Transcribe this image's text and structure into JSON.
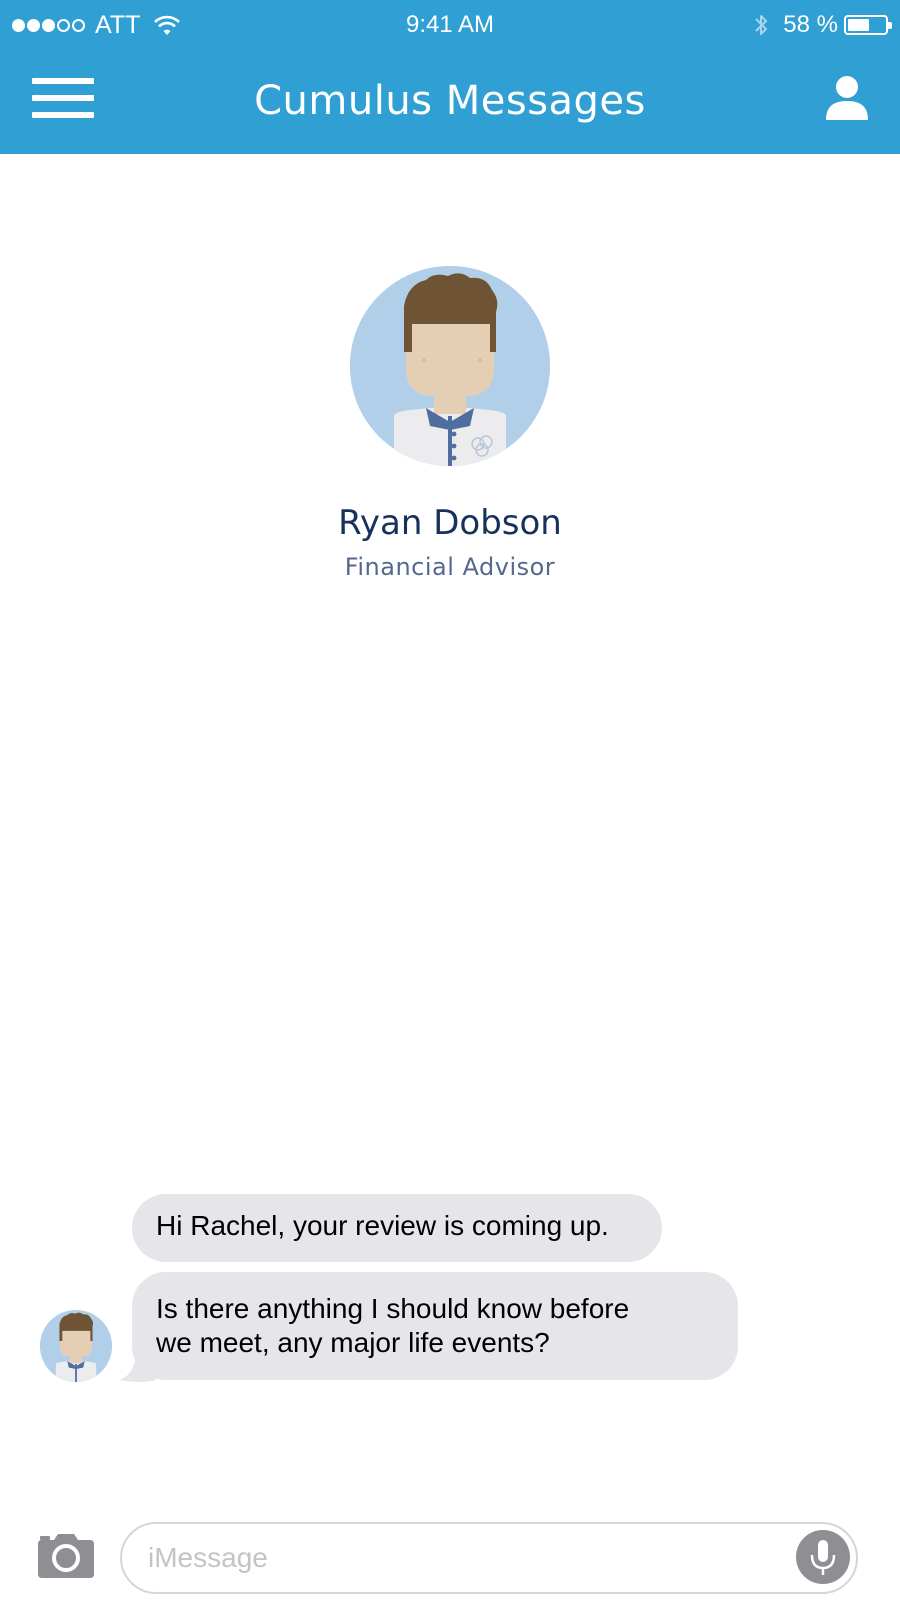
{
  "status_bar": {
    "signal_icon": "signal-dots-icon",
    "carrier": "ATT",
    "wifi_icon": "wifi-icon",
    "time": "9:41 AM",
    "bluetooth_icon": "bluetooth-icon",
    "battery_text": "58 %",
    "battery_level": 0.58
  },
  "nav": {
    "menu_icon": "hamburger-menu-icon",
    "title": "Cumulus Messages",
    "profile_icon": "person-icon"
  },
  "contact": {
    "avatar_icon": "person-avatar-icon",
    "name": "Ryan Dobson",
    "role": "Financial Advisor"
  },
  "messages": [
    {
      "direction": "incoming",
      "text": "Hi Rachel, your review is coming up."
    },
    {
      "direction": "incoming",
      "lines": [
        "Is there anything I should know before",
        "we meet, any major life events?"
      ]
    }
  ],
  "input_bar": {
    "camera_icon": "camera-icon",
    "placeholder": "iMessage",
    "value": "",
    "mic_icon": "microphone-icon"
  },
  "colors": {
    "header_blue": "#2f9fd4",
    "bubble_gray": "#e5e5ea",
    "name_navy": "#16325c",
    "role_slate": "#54698d",
    "avatar_bg": "#b2cfe9"
  }
}
